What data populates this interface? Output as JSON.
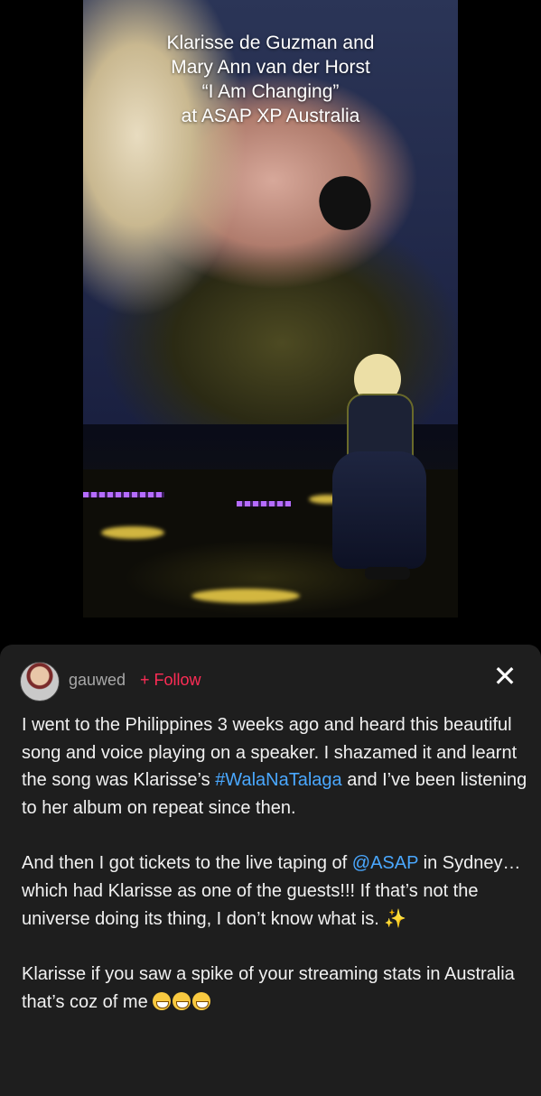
{
  "video": {
    "caption_lines": [
      "Klarisse de Guzman and",
      "Mary Ann van der Horst",
      "“I Am Changing”",
      "at ASAP XP Australia"
    ]
  },
  "comment": {
    "username": "gauwed",
    "follow_label": "+ Follow",
    "close_label": "✕",
    "para1": {
      "part1": "I went to the Philippines 3 weeks ago and heard this beautiful song and voice playing on a speaker. I shazamed it and learnt the song was Klarisse’s ",
      "hashtag": "#WalaNaTalaga",
      "part2": " and I’ve been listening to her album on repeat since then."
    },
    "para2": {
      "part1": "And then I got tickets to the live taping of ",
      "mention": "@ASAP",
      "part2": " in Sydney… which had Klarisse as one of the guests!!! If that’s not the universe doing its thing, I don’t know what is. ",
      "sparkle": "✨"
    },
    "para3": {
      "text": "Klarisse if you saw a spike of your streaming stats in Australia that’s coz of me "
    }
  }
}
